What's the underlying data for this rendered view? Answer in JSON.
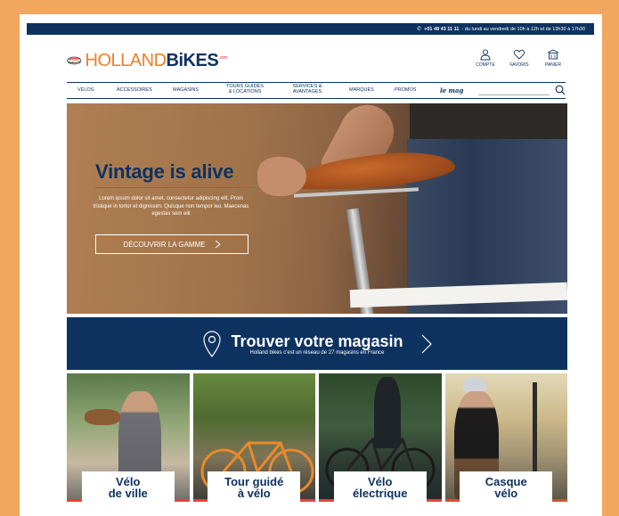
{
  "topbar": {
    "phone": "+01 48 43 11 11",
    "hours": " - du lundi au vendredi de 10h à 12h et de 13h30 à 17h30"
  },
  "logo": {
    "text_light": "HOLLAND",
    "text_bold": "BiKES",
    "suffix": ".com"
  },
  "header_actions": [
    {
      "label": "COMPTE",
      "icon": "user-icon"
    },
    {
      "label": "FAVORIS",
      "icon": "heart-icon"
    },
    {
      "label": "PANIER",
      "icon": "cart-icon"
    }
  ],
  "nav": {
    "items": [
      "VÉLOS",
      "ACCESSOIRES",
      "MAGASINS",
      "TOURS GUIDÉS\n& LOCATIONS",
      "SERVICES &\nAVANTAGES",
      "MARQUES",
      "PROMOS",
      "le mag"
    ],
    "search_placeholder": ""
  },
  "hero": {
    "title": "Vintage is alive",
    "text": "Lorem ipsum dolor sit amet, consectetur adipiscing elit. Proin tristique in tortor et dignissim. Quisque non tempor leo. Maecenas egestas sem elit",
    "cta": "DÉCOUVRIR LA GAMME"
  },
  "store_finder": {
    "title": "Trouver votre magasin",
    "subtitle": "Holland bikes c'est un réseau de 27 magasins en France"
  },
  "tiles": [
    {
      "label": "Vélo\nde ville"
    },
    {
      "label": "Tour guidé\nà vélo"
    },
    {
      "label": "Vélo\nélectrique"
    },
    {
      "label": "Casque\nvélo"
    }
  ],
  "colors": {
    "navy": "#0d3260",
    "orange": "#f07e26",
    "accent_red": "#e44530",
    "frame": "#f2a760"
  }
}
